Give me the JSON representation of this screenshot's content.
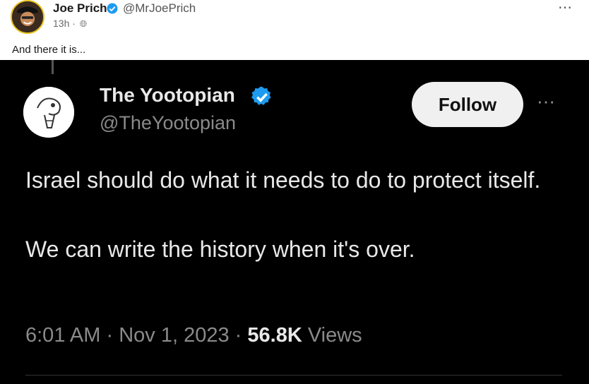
{
  "post": {
    "author_name": "Joe Prich",
    "author_handle": "@MrJoePrich",
    "timestamp": "13h",
    "separator": "·",
    "visibility_icon": "globe-icon",
    "caption": "And there it is...",
    "more_icon": "more-options-icon"
  },
  "tweet": {
    "name": "The Yootopian",
    "handle": "@TheYootopian",
    "follow_label": "Follow",
    "line1": "Israel should do what it needs to do to protect itself.",
    "line2": "We can write the history when it's over.",
    "time": "6:01 AM",
    "date": "Nov 1, 2023",
    "sep": "·",
    "views_count": "56.8K",
    "views_label": "Views"
  },
  "colors": {
    "verified": "#1d9bf0",
    "tweet_bg": "#000000",
    "follow_bg": "#f0f0f0"
  }
}
